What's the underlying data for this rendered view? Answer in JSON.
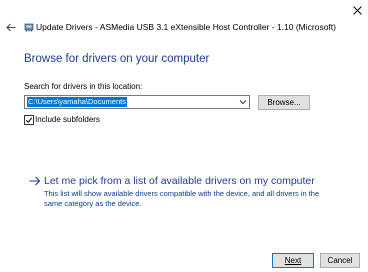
{
  "window": {
    "title": "Update Drivers - ASMedia USB 3.1 eXtensible Host Controller - 1.10 (Microsoft)"
  },
  "heading": "Browse for drivers on your computer",
  "search": {
    "label": "Search for drivers in this location:",
    "path_value": "C:\\Users\\yamaha\\Documents",
    "browse_label": "Browse..."
  },
  "include_subfolders": {
    "label": "Include subfolders",
    "checked": true
  },
  "pick_option": {
    "title": "Let me pick from a list of available drivers on my computer",
    "description": "This list will show available drivers compatible with the device, and all drivers in the same category as the device."
  },
  "buttons": {
    "next": "Next",
    "cancel": "Cancel"
  },
  "colors": {
    "accent": "#0078d7",
    "heading": "#1c3d8f",
    "button_bg": "#e1e1e1"
  }
}
